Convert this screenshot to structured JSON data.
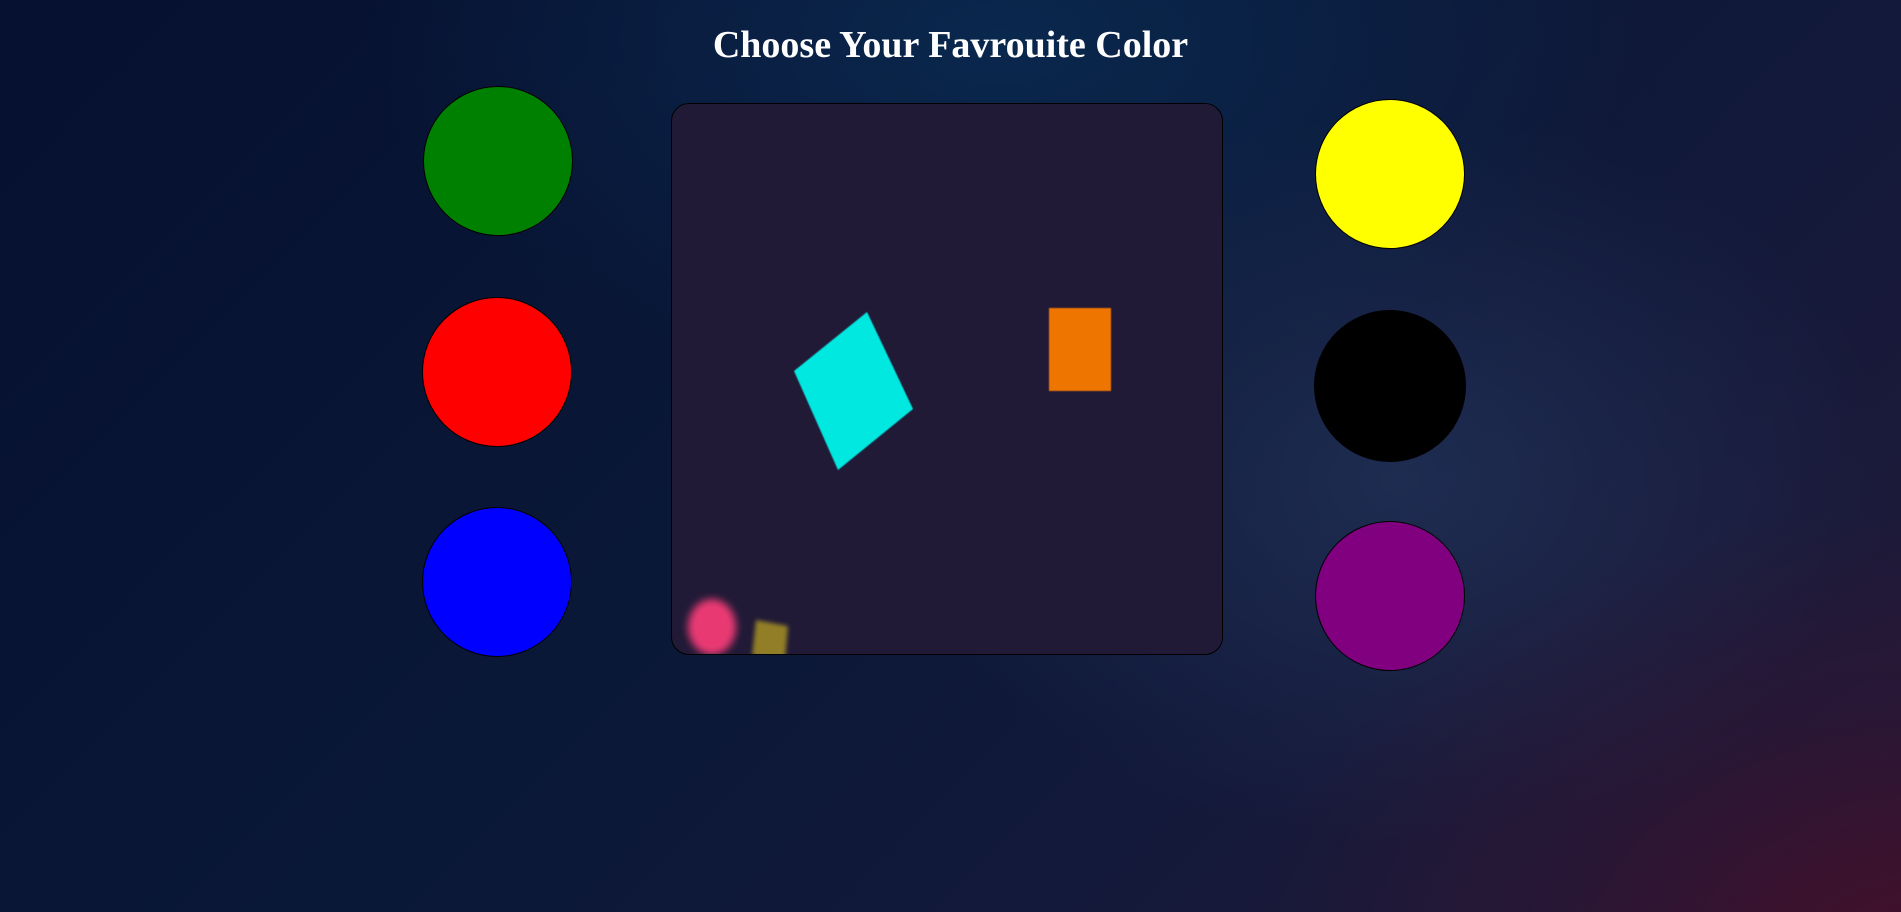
{
  "header": {
    "title": "Choose Your Favrouite Color"
  },
  "palette": {
    "left": [
      {
        "name": "green",
        "color": "#008000"
      },
      {
        "name": "red",
        "color": "#ff0000"
      },
      {
        "name": "blue",
        "color": "#0000ff"
      }
    ],
    "right": [
      {
        "name": "yellow",
        "color": "#ffff00"
      },
      {
        "name": "black",
        "color": "#000000"
      },
      {
        "name": "purple",
        "color": "#800080"
      }
    ]
  },
  "canvas": {
    "background": "#211a37",
    "shapes": [
      {
        "kind": "rotated-square",
        "color": "#00e8e0"
      },
      {
        "kind": "rectangle",
        "color": "#ee7600"
      },
      {
        "kind": "blurred-circle",
        "color": "#ff3d7a"
      },
      {
        "kind": "blurred-square",
        "color": "#b8a020"
      }
    ]
  }
}
